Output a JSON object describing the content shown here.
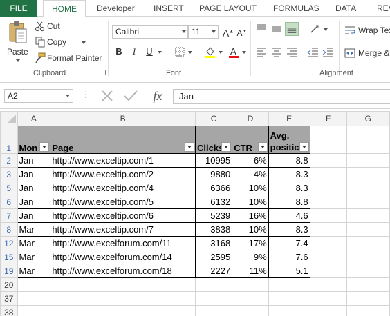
{
  "tabs": [
    "FILE",
    "HOME",
    "Developer",
    "INSERT",
    "PAGE LAYOUT",
    "FORMULAS",
    "DATA",
    "REV"
  ],
  "clipboard": {
    "paste": "Paste",
    "cut": "Cut",
    "copy": "Copy",
    "format_painter": "Format Painter",
    "group_label": "Clipboard"
  },
  "font": {
    "name": "Calibri",
    "size": "11",
    "bold": "B",
    "italic": "I",
    "underline": "U",
    "group_label": "Font"
  },
  "alignment": {
    "wrap_text": "Wrap Tex",
    "merge": "Merge &",
    "group_label": "Alignment"
  },
  "formula_bar": {
    "name_box": "A2",
    "fx": "fx",
    "content": "Jan"
  },
  "colors": {
    "accent": "#217346",
    "header_fill": "#a6a6a6",
    "row_number": "#3d6ab3"
  },
  "columns": [
    "A",
    "B",
    "C",
    "D",
    "E",
    "F",
    "G"
  ],
  "header_row": {
    "num": "1",
    "cells": [
      "Mon",
      "Page",
      "Clicks",
      "CTR",
      "Avg.\npositic"
    ]
  },
  "rows": [
    {
      "num": "2",
      "month": "Jan",
      "page": "http://www.exceltip.com/1",
      "clicks": "10995",
      "ctr": "6%",
      "pos": "8.8"
    },
    {
      "num": "3",
      "month": "Jan",
      "page": "http://www.exceltip.com/2",
      "clicks": "9880",
      "ctr": "4%",
      "pos": "8.3"
    },
    {
      "num": "5",
      "month": "Jan",
      "page": "http://www.exceltip.com/4",
      "clicks": "6366",
      "ctr": "10%",
      "pos": "8.3"
    },
    {
      "num": "6",
      "month": "Jan",
      "page": "http://www.exceltip.com/5",
      "clicks": "6132",
      "ctr": "10%",
      "pos": "8.8"
    },
    {
      "num": "7",
      "month": "Jan",
      "page": "http://www.exceltip.com/6",
      "clicks": "5239",
      "ctr": "16%",
      "pos": "4.6"
    },
    {
      "num": "8",
      "month": "Mar",
      "page": "http://www.exceltip.com/7",
      "clicks": "3838",
      "ctr": "10%",
      "pos": "8.3"
    },
    {
      "num": "12",
      "month": "Mar",
      "page": "http://www.excelforum.com/11",
      "clicks": "3168",
      "ctr": "17%",
      "pos": "7.4"
    },
    {
      "num": "15",
      "month": "Mar",
      "page": "http://www.excelforum.com/14",
      "clicks": "2595",
      "ctr": "9%",
      "pos": "7.6"
    },
    {
      "num": "19",
      "month": "Mar",
      "page": "http://www.excelforum.com/18",
      "clicks": "2227",
      "ctr": "11%",
      "pos": "5.1"
    }
  ],
  "empty_rows": [
    "20",
    "37",
    "38"
  ]
}
